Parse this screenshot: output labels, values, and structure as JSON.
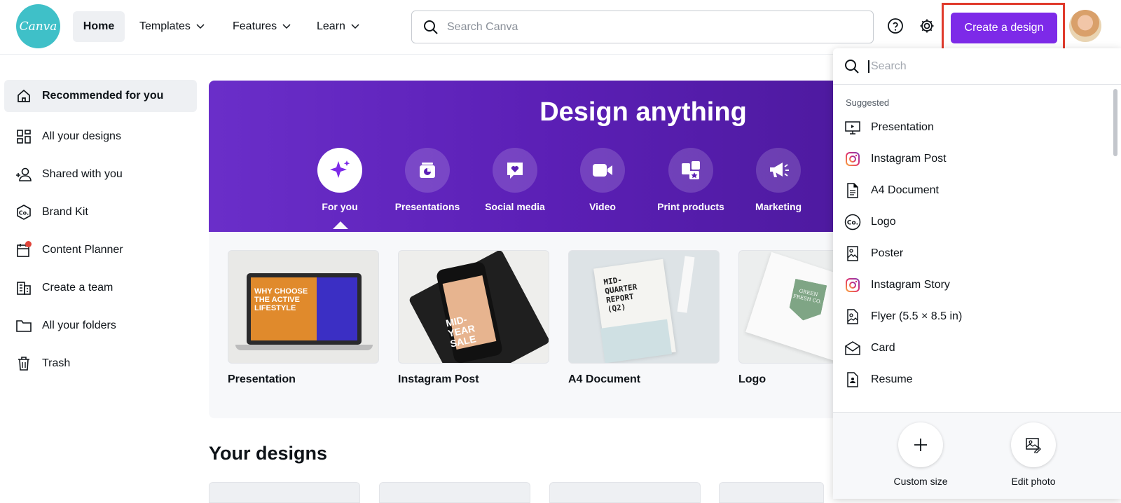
{
  "header": {
    "logo_text": "Canva",
    "nav": {
      "home": "Home",
      "templates": "Templates",
      "features": "Features",
      "learn": "Learn"
    },
    "search_placeholder": "Search Canva",
    "create_label": "Create a design",
    "icons": [
      "help-icon",
      "settings-icon"
    ]
  },
  "sidebar": {
    "items": [
      {
        "label": "Recommended for you",
        "icon": "home-icon"
      },
      {
        "label": "All your designs",
        "icon": "grid-icon"
      },
      {
        "label": "Shared with you",
        "icon": "people-icon"
      },
      {
        "label": "Brand Kit",
        "icon": "brand-kit-icon"
      },
      {
        "label": "Content Planner",
        "icon": "calendar-icon"
      },
      {
        "label": "Create a team",
        "icon": "building-icon"
      },
      {
        "label": "All your folders",
        "icon": "folder-icon"
      },
      {
        "label": "Trash",
        "icon": "trash-icon"
      }
    ]
  },
  "hero": {
    "title": "Design anything",
    "categories": [
      {
        "label": "For you",
        "icon": "sparkle-icon"
      },
      {
        "label": "Presentations",
        "icon": "presentation-icon"
      },
      {
        "label": "Social media",
        "icon": "heart-bubble-icon"
      },
      {
        "label": "Video",
        "icon": "video-icon"
      },
      {
        "label": "Print products",
        "icon": "print-icon"
      },
      {
        "label": "Marketing",
        "icon": "megaphone-icon"
      }
    ]
  },
  "cards": [
    {
      "label": "Presentation",
      "thumb_text": "WHY CHOOSE THE ACTIVE LIFESTYLE"
    },
    {
      "label": "Instagram Post",
      "thumb_text": "MID-YEAR SALE"
    },
    {
      "label": "A4 Document",
      "thumb_text": "MID-QUARTER REPORT (Q2)"
    },
    {
      "label": "Logo",
      "thumb_text": "GREEN FRESH CO."
    }
  ],
  "your_designs_title": "Your designs",
  "dropdown": {
    "search_placeholder": "Search",
    "suggested_heading": "Suggested",
    "items": [
      {
        "label": "Presentation",
        "icon": "presentation-icon"
      },
      {
        "label": "Instagram Post",
        "icon": "instagram-icon"
      },
      {
        "label": "A4 Document",
        "icon": "document-icon"
      },
      {
        "label": "Logo",
        "icon": "logo-co-icon"
      },
      {
        "label": "Poster",
        "icon": "poster-icon"
      },
      {
        "label": "Instagram Story",
        "icon": "instagram-icon"
      },
      {
        "label": "Flyer (5.5 × 8.5 in)",
        "icon": "flyer-icon"
      },
      {
        "label": "Card",
        "icon": "card-icon"
      },
      {
        "label": "Resume",
        "icon": "resume-icon"
      }
    ],
    "footer": {
      "custom_size": "Custom size",
      "edit_photo": "Edit photo"
    }
  },
  "colors": {
    "brand_purple": "#7d2ae8",
    "logo_teal": "#3fc0c8",
    "highlight_red": "#e03a2c"
  }
}
